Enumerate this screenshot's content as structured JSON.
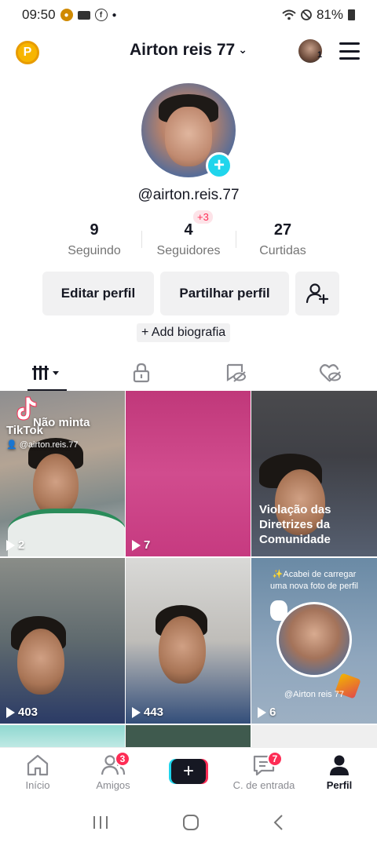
{
  "status_bar": {
    "time": "09:50",
    "battery": "81%",
    "icons": [
      "pinterest-like-icon",
      "video-camera-icon",
      "facebook-icon",
      "dot-icon",
      "wifi-icon",
      "dnd-icon",
      "battery-icon"
    ]
  },
  "header": {
    "coin_letter": "P",
    "title": "Airton reis 77",
    "avatar_badge": "1"
  },
  "profile": {
    "handle": "@airton.reis.77",
    "stats": [
      {
        "value": "9",
        "label": "Seguindo"
      },
      {
        "value": "4",
        "label": "Seguidores"
      },
      {
        "value": "27",
        "label": "Curtidas"
      }
    ],
    "followers_delta": "+3"
  },
  "actions": {
    "edit": "Editar perfil",
    "share": "Partilhar perfil",
    "bio": "+ Add biografia"
  },
  "tabs": [
    "videos-grid-icon",
    "lock-icon",
    "reposts-hidden-icon",
    "liked-hidden-icon"
  ],
  "videos": [
    {
      "views": "2",
      "title": "Não minta",
      "brand": "TikTok",
      "author": "@airton.reis.77"
    },
    {
      "views": "7"
    },
    {
      "views": "",
      "notice": "Violação das Diretrizes da Comunidade"
    },
    {
      "views": "403"
    },
    {
      "views": "443"
    },
    {
      "views": "6",
      "promo_text": "✨Acabei de carregar uma nova foto de perfil",
      "promo_handle": "@Airton reis 77"
    }
  ],
  "bottom_nav": [
    {
      "label": "Início",
      "badge": ""
    },
    {
      "label": "Amigos",
      "badge": "3"
    },
    {
      "label": "",
      "badge": ""
    },
    {
      "label": "C. de entrada",
      "badge": "7"
    },
    {
      "label": "Perfil",
      "badge": ""
    }
  ],
  "colors": {
    "accent": "#fe2c55",
    "cyan": "#20d5ec",
    "text": "#161823",
    "muted": "#757575"
  }
}
